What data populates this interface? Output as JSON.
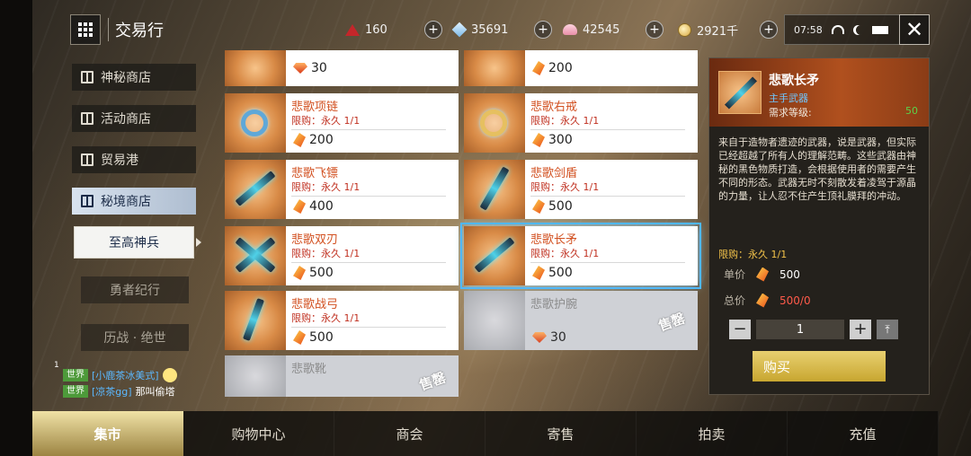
{
  "header": {
    "title": "交易行",
    "currencies": [
      {
        "icon": "red-crystal-icon",
        "value": "160"
      },
      {
        "icon": "diamond-icon",
        "value": "35691"
      },
      {
        "icon": "shell-icon",
        "value": "42545"
      },
      {
        "icon": "gold-coin-icon",
        "value": "2921千"
      }
    ],
    "time": "07:58"
  },
  "nav": {
    "items": [
      {
        "label": "神秘商店"
      },
      {
        "label": "活动商店"
      },
      {
        "label": "贸易港"
      },
      {
        "label": "秘境商店"
      }
    ],
    "sub_item": "至高神兵",
    "dim_items": [
      {
        "label": "勇者纪行"
      },
      {
        "label": "历战 · 绝世"
      }
    ]
  },
  "chat": {
    "count": "1",
    "lines": [
      {
        "tag": "世界",
        "name": "[小鹿茶冰美式]",
        "msg": ""
      },
      {
        "tag": "世界",
        "name": "[凉茶gg]",
        "msg": "那叫偷塔"
      }
    ]
  },
  "items": [
    {
      "name": "",
      "limit": "",
      "price": "30",
      "currency": "gem",
      "sold_out": false
    },
    {
      "name": "",
      "limit": "",
      "price": "200",
      "currency": "feather",
      "sold_out": false
    },
    {
      "name": "悲歌项链",
      "limit": "限购：永久 1/1",
      "price": "200",
      "currency": "feather",
      "sold_out": false
    },
    {
      "name": "悲歌右戒",
      "limit": "限购：永久 1/1",
      "price": "300",
      "currency": "feather",
      "sold_out": false
    },
    {
      "name": "悲歌飞镖",
      "limit": "限购：永久 1/1",
      "price": "400",
      "currency": "feather",
      "sold_out": false
    },
    {
      "name": "悲歌剑盾",
      "limit": "限购：永久 1/1",
      "price": "500",
      "currency": "feather",
      "sold_out": false
    },
    {
      "name": "悲歌双刃",
      "limit": "限购：永久 1/1",
      "price": "500",
      "currency": "feather",
      "sold_out": false
    },
    {
      "name": "悲歌长矛",
      "limit": "限购：永久 1/1",
      "price": "500",
      "currency": "feather",
      "sold_out": false,
      "selected": true
    },
    {
      "name": "悲歌战弓",
      "limit": "限购：永久 1/1",
      "price": "500",
      "currency": "feather",
      "sold_out": false
    },
    {
      "name": "悲歌护腕",
      "limit": "",
      "price": "30",
      "currency": "gem",
      "sold_out": true
    },
    {
      "name": "悲歌靴",
      "limit": "",
      "price": "",
      "currency": "",
      "sold_out": true
    }
  ],
  "sold_out_label": "售罄",
  "detail": {
    "name": "悲歌长矛",
    "type": "主手武器",
    "req_label": "需求等级:",
    "req_value": "50",
    "description": "来自于造物者遗迹的武器，说是武器，但实际已经超越了所有人的理解范畴。这些武器由神秘的黑色物质打造，会根据使用者的需要产生不同的形态。武器无时不刻散发着凌驾于源晶的力量，让人忍不住产生顶礼膜拜的冲动。",
    "limit": "限购：永久 1/1",
    "unit_label": "单价",
    "unit_price": "500",
    "total_label": "总价",
    "total_price": "500/0",
    "quantity": "1",
    "buy_label": "购买"
  },
  "tabs": [
    {
      "label": "集市",
      "active": true
    },
    {
      "label": "购物中心"
    },
    {
      "label": "商会"
    },
    {
      "label": "寄售"
    },
    {
      "label": "拍卖"
    },
    {
      "label": "充值"
    }
  ]
}
